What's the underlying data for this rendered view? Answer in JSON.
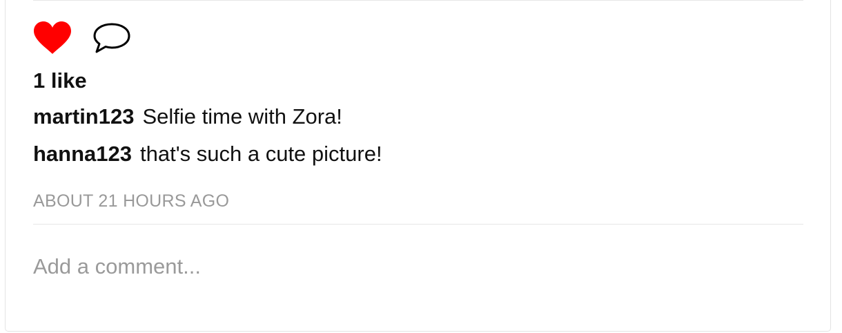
{
  "post": {
    "likes_text": "1 like",
    "comments": [
      {
        "user": "martin123",
        "text": "Selfie time with Zora!"
      },
      {
        "user": "hanna123",
        "text": "that's such a cute picture!"
      }
    ],
    "timestamp": "ABOUT 21 HOURS AGO",
    "comment_placeholder": "Add a comment...",
    "liked": true
  },
  "icons": {
    "like": "heart-icon",
    "comment": "speech-bubble-icon"
  },
  "colors": {
    "heart": "#ff0000",
    "muted_text": "#999999",
    "divider": "#e6e6e6"
  }
}
